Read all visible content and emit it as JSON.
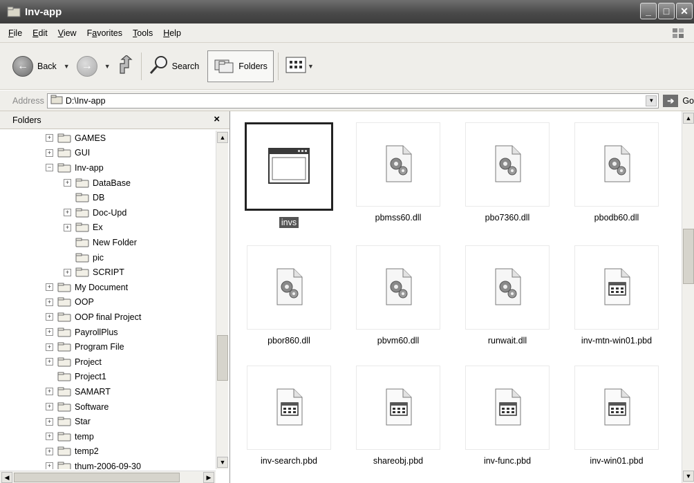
{
  "window": {
    "title": "Inv-app"
  },
  "menu": [
    {
      "label": "File",
      "key": "F",
      "rest": "ile"
    },
    {
      "label": "Edit",
      "key": "E",
      "rest": "dit"
    },
    {
      "label": "View",
      "key": "V",
      "rest": "iew"
    },
    {
      "label": "Favorites",
      "key": "a",
      "pre": "F",
      "rest": "vorites"
    },
    {
      "label": "Tools",
      "key": "T",
      "rest": "ools"
    },
    {
      "label": "Help",
      "key": "H",
      "rest": "elp"
    }
  ],
  "toolbar": {
    "back_label": "Back",
    "search_label": "Search",
    "folders_label": "Folders"
  },
  "address": {
    "label": "Address",
    "value": "D:\\Inv-app",
    "go_label": "Go"
  },
  "folders_pane": {
    "title": "Folders",
    "close_glyph": "×",
    "tree": [
      {
        "label": "GAMES",
        "level": 0,
        "expander": "+"
      },
      {
        "label": "GUI",
        "level": 0,
        "expander": "+"
      },
      {
        "label": "Inv-app",
        "level": 0,
        "expander": "−",
        "open": true
      },
      {
        "label": "DataBase",
        "level": 1,
        "expander": "+"
      },
      {
        "label": "DB",
        "level": 1,
        "expander": ""
      },
      {
        "label": "Doc-Upd",
        "level": 1,
        "expander": "+"
      },
      {
        "label": "Ex",
        "level": 1,
        "expander": "+"
      },
      {
        "label": "New Folder",
        "level": 1,
        "expander": ""
      },
      {
        "label": "pic",
        "level": 1,
        "expander": ""
      },
      {
        "label": "SCRIPT",
        "level": 1,
        "expander": "+"
      },
      {
        "label": "My Document",
        "level": 0,
        "expander": "+"
      },
      {
        "label": "OOP",
        "level": 0,
        "expander": "+"
      },
      {
        "label": "OOP final Project",
        "level": 0,
        "expander": "+"
      },
      {
        "label": "PayrollPlus",
        "level": 0,
        "expander": "+"
      },
      {
        "label": "Program File",
        "level": 0,
        "expander": "+"
      },
      {
        "label": "Project",
        "level": 0,
        "expander": "+"
      },
      {
        "label": "Project1",
        "level": 0,
        "expander": ""
      },
      {
        "label": "SAMART",
        "level": 0,
        "expander": "+"
      },
      {
        "label": "Software",
        "level": 0,
        "expander": "+"
      },
      {
        "label": "Star",
        "level": 0,
        "expander": "+"
      },
      {
        "label": "temp",
        "level": 0,
        "expander": "+"
      },
      {
        "label": "temp2",
        "level": 0,
        "expander": "+"
      },
      {
        "label": "thum-2006-09-30",
        "level": 0,
        "expander": "+"
      }
    ]
  },
  "files": [
    {
      "name": "invs",
      "icon": "application-window-icon",
      "selected": true
    },
    {
      "name": "pbmss60.dll",
      "icon": "dll-gear-icon"
    },
    {
      "name": "pbo7360.dll",
      "icon": "dll-gear-icon"
    },
    {
      "name": "pbodb60.dll",
      "icon": "dll-gear-icon"
    },
    {
      "name": "pbor860.dll",
      "icon": "dll-gear-icon"
    },
    {
      "name": "pbvm60.dll",
      "icon": "dll-gear-icon"
    },
    {
      "name": "runwait.dll",
      "icon": "dll-gear-icon"
    },
    {
      "name": "inv-mtn-win01.pbd",
      "icon": "pbd-file-icon"
    },
    {
      "name": "inv-search.pbd",
      "icon": "pbd-file-icon"
    },
    {
      "name": "shareobj.pbd",
      "icon": "pbd-file-icon"
    },
    {
      "name": "inv-func.pbd",
      "icon": "pbd-file-icon"
    },
    {
      "name": "inv-win01.pbd",
      "icon": "pbd-file-icon"
    }
  ],
  "colors": {
    "titlebar": "#4a4a4a",
    "chrome": "#efeeea",
    "selection": "#555555"
  }
}
